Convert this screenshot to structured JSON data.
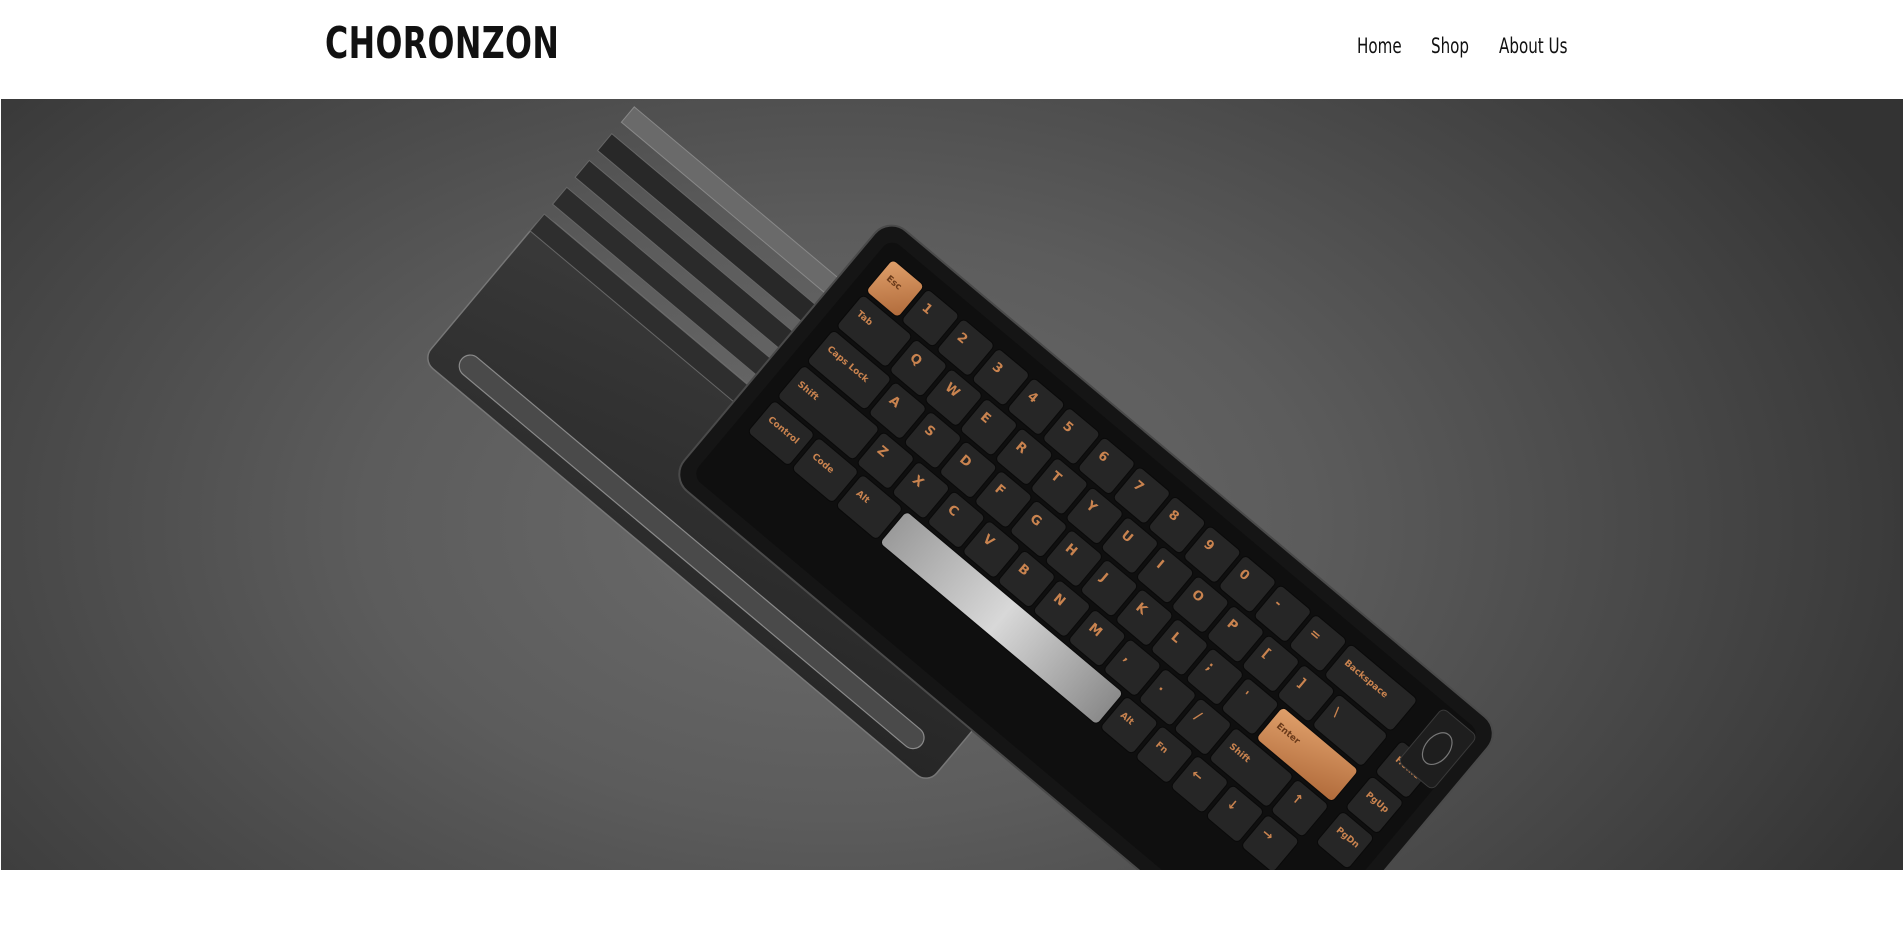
{
  "brand": {
    "name": "CHORONZON"
  },
  "nav": {
    "items": [
      {
        "label": "Home"
      },
      {
        "label": "Shop"
      },
      {
        "label": "About Us"
      }
    ]
  },
  "hero": {
    "image": "mechanical-keyboard-with-wrist-rest",
    "keycap_legends": {
      "esc": "Esc",
      "tab": "Tab",
      "caps": "Caps Lock",
      "shift_left": "Shift",
      "control": "Control",
      "code": "Code",
      "alt_left": "Alt",
      "backspace": "Backspace",
      "enter": "Enter",
      "shift_right": "Shift",
      "alt_right": "Alt",
      "fn": "Fn",
      "home": "Home",
      "pgup": "PgUp",
      "pgdn": "PgDn",
      "letters_row2": [
        "Q",
        "W",
        "E",
        "R",
        "T",
        "Y",
        "U",
        "I",
        "O",
        "P"
      ],
      "letters_row3": [
        "A",
        "S",
        "D",
        "F",
        "G",
        "H",
        "J",
        "K",
        "L"
      ],
      "letters_row4": [
        "Z",
        "X",
        "C",
        "V",
        "B",
        "N",
        "M"
      ],
      "numbers": [
        "1",
        "2",
        "3",
        "4",
        "5",
        "6",
        "7",
        "8",
        "9",
        "0"
      ]
    }
  },
  "colors": {
    "accent_copper": "#c9834f",
    "keycap_dark": "#262626",
    "case": "#1c1c1c",
    "header_bg": "#ffffff",
    "hero_bg": "#5c5c5c"
  }
}
